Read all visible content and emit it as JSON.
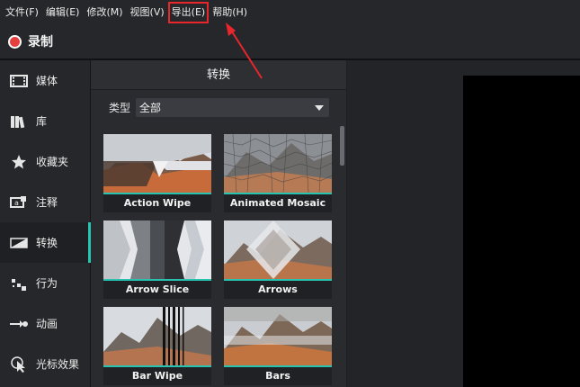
{
  "menu": [
    "文件(F)",
    "编辑(E)",
    "修改(M)",
    "视图(V)",
    "导出(E)",
    "帮助(H)"
  ],
  "highlighted_menu": "导出(E)",
  "record": {
    "label": "录制"
  },
  "sidebar": {
    "items": [
      {
        "label": "媒体",
        "icon": "film-icon"
      },
      {
        "label": "库",
        "icon": "library-icon"
      },
      {
        "label": "收藏夹",
        "icon": "star-icon"
      },
      {
        "label": "注释",
        "icon": "annotation-icon"
      },
      {
        "label": "转换",
        "icon": "transition-icon",
        "active": true
      },
      {
        "label": "行为",
        "icon": "behavior-icon"
      },
      {
        "label": "动画",
        "icon": "animation-icon"
      },
      {
        "label": "光标效果",
        "icon": "cursor-effect-icon"
      }
    ]
  },
  "panel": {
    "title": "转换",
    "filter": {
      "label": "类型",
      "value": "全部"
    },
    "transitions": [
      "Action Wipe",
      "Animated Mosaic",
      "Arrow Slice",
      "Arrows",
      "Bar Wipe",
      "Bars"
    ]
  },
  "colors": {
    "accent": "#27c4b0",
    "highlight": "#e8262c",
    "record": "#e53f3f"
  }
}
